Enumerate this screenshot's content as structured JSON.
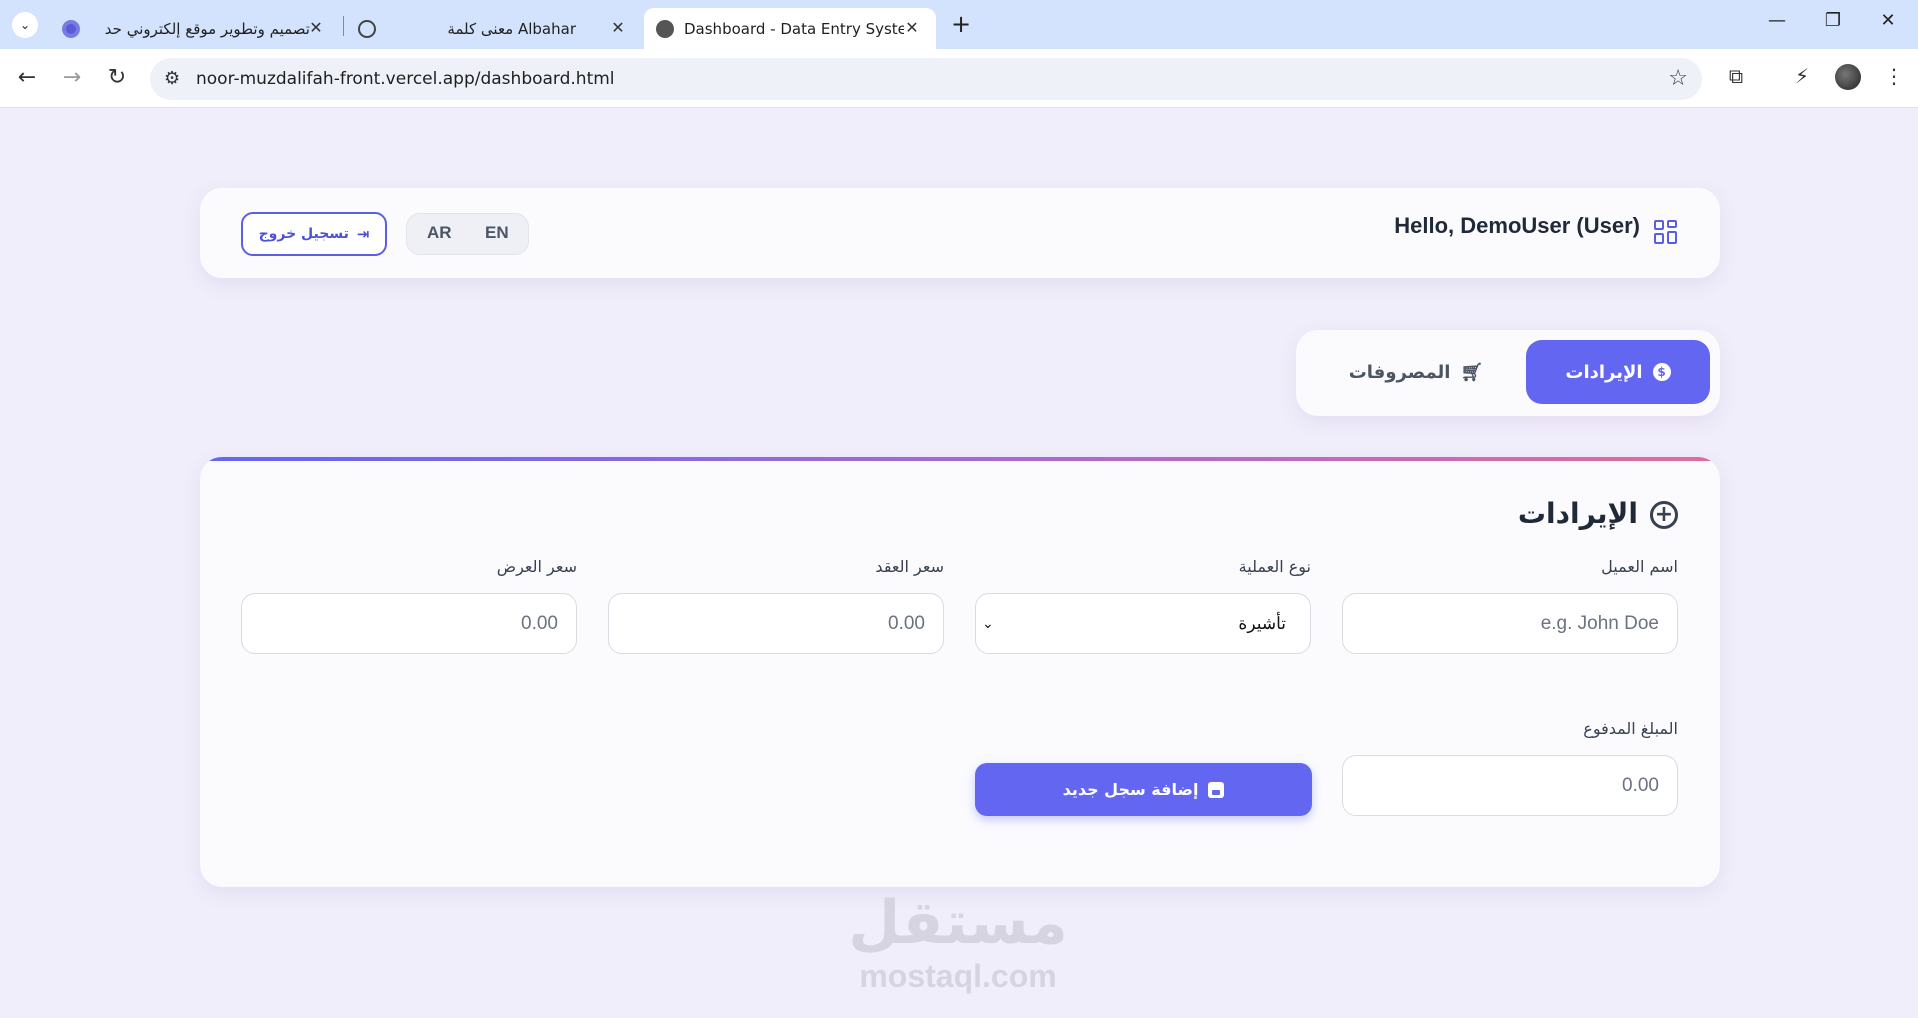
{
  "browser": {
    "tabs": [
      {
        "title": "تصميم وتطوير موقع إلكتروني حد",
        "favicon": "mostaql-icon"
      },
      {
        "title": "معنى كلمة Albahar",
        "favicon": "chatgpt-icon"
      },
      {
        "title": "Dashboard - Data Entry System",
        "favicon": "globe-icon"
      }
    ],
    "url": "noor-muzdalifah-front.vercel.app/dashboard.html"
  },
  "header": {
    "greeting": "Hello, DemoUser (User)",
    "lang_ar": "AR",
    "lang_en": "EN",
    "logout_label": "تسجيل خروج"
  },
  "nav": {
    "revenues_label": "الإيرادات",
    "expenses_label": "المصروفات",
    "active": "revenues"
  },
  "form": {
    "title": "الإيرادات",
    "fields": {
      "client_name": {
        "label": "اسم العميل",
        "placeholder": "e.g. John Doe"
      },
      "operation_type": {
        "label": "نوع العملية",
        "value": "تأشيرة"
      },
      "contract_price": {
        "label": "سعر العقد",
        "placeholder": "0.00"
      },
      "offer_price": {
        "label": "سعر العرض",
        "placeholder": "0.00"
      },
      "paid_amount": {
        "label": "المبلغ المدفوع",
        "placeholder": "0.00"
      }
    },
    "submit_label": "إضافة سجل جديد"
  },
  "watermark": {
    "ar": "مستقل",
    "en": "mostaql.com"
  },
  "colors": {
    "primary": "#6366f1",
    "background": "#f1eefb",
    "card": "#fbfbfe"
  }
}
